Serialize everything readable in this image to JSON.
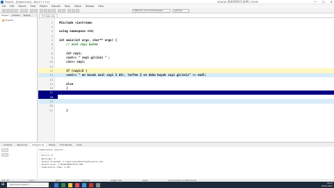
{
  "window": {
    "title": "Project1 - [Project1.dev] - Dev-C++ 5.11",
    "watermark": "www.BANDICAM.com",
    "controls": [
      "—",
      "☐",
      "✕"
    ]
  },
  "menu": [
    "File",
    "Edit",
    "Search",
    "View",
    "Project",
    "Execute",
    "Tools",
    "AStyle",
    "Window",
    "Help"
  ],
  "toolbar": {
    "compiler_select": "TDM-GCC 4.9.2 64-bit Release",
    "config_select": "(globals)"
  },
  "left_panel": {
    "tabs": [
      "Project",
      "Classes",
      "Debug"
    ],
    "tree_root": "Project1"
  },
  "editor": {
    "tab_label": "[*] main.cpp",
    "lines": [
      {
        "n": "1",
        "text": "#include <iostream>"
      },
      {
        "n": "2",
        "text": ""
      },
      {
        "n": "3",
        "text": "using namespace std;"
      },
      {
        "n": "4",
        "text": ""
      },
      {
        "n": "5",
        "text": "int main(int argc, char** argv) {"
      },
      {
        "n": "6",
        "text": "    // asal sayı bulma"
      },
      {
        "n": "7",
        "text": ""
      },
      {
        "n": "8",
        "text": "    int sayi;"
      },
      {
        "n": "9",
        "text": "    cout<< \" sayi giriniz \" ;"
      },
      {
        "n": "10",
        "text": "    cin>> sayi;"
      },
      {
        "n": "11",
        "text": ""
      },
      {
        "n": "12",
        "text": "    if (sayi<2 )"
      },
      {
        "n": "13",
        "text": "    cout<< \" en kucuk asal sayi 2 dir, lutfen 2 ve daha buyuk sayi giriniz\" << endl;"
      },
      {
        "n": "14",
        "text": ""
      },
      {
        "n": "15",
        "text": "    else"
      },
      {
        "n": "16",
        "text": "    {"
      },
      {
        "n": "17",
        "text": ""
      },
      {
        "n": "18",
        "text": ""
      },
      {
        "n": "19",
        "text": ""
      },
      {
        "n": "20",
        "text": ""
      },
      {
        "n": "21",
        "text": "    }"
      }
    ]
  },
  "bottom_panel": {
    "tabs": [
      "Compiler",
      "Resources",
      "Compile Log",
      "Debug",
      "Find Results",
      "Close"
    ],
    "log_lines": [
      "Compilation results...",
      "--------",
      "- Errors: 0",
      "- Warnings: 0",
      "- Output Filename: C:\\Users\\pc\\Desktop\\Project1.exe",
      "- Output Size: 1.83187389373779 MiB",
      "- Compilation Time: 1.23s"
    ]
  },
  "statusbar": {
    "line": "Line: 18",
    "col": "Col: 1",
    "sel": "Sel: 0",
    "lines": "Lines: 24",
    "length": "Length: 342",
    "insert": "Insert",
    "msg": "Done parsing in 0.016 seconds"
  },
  "taskbar": {
    "search_placeholder": "Type here to search",
    "time": "20:17",
    "date": "24.02.2021"
  }
}
